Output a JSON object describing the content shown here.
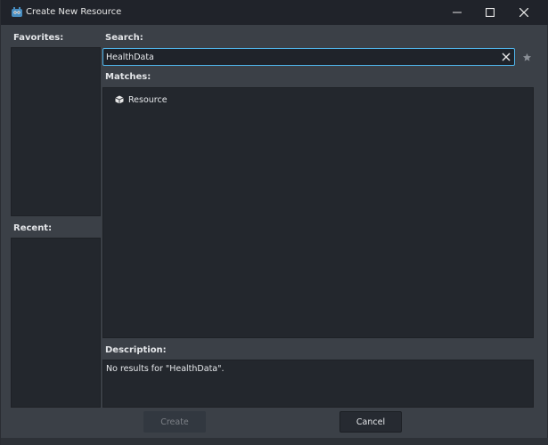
{
  "window": {
    "title": "Create New Resource"
  },
  "sections": {
    "favorites_label": "Favorites:",
    "recent_label": "Recent:",
    "search_label": "Search:",
    "matches_label": "Matches:",
    "description_label": "Description:"
  },
  "search": {
    "value": "HealthData"
  },
  "matches": [
    {
      "label": "Resource",
      "icon": "cube-icon"
    }
  ],
  "description": {
    "text": "No results for \"HealthData\"."
  },
  "buttons": {
    "create": "Create",
    "cancel": "Cancel"
  },
  "colors": {
    "accent": "#4fb3e8",
    "window_bg": "#3b4047",
    "panel_bg": "#23272d",
    "titlebar_bg": "#20232a"
  }
}
